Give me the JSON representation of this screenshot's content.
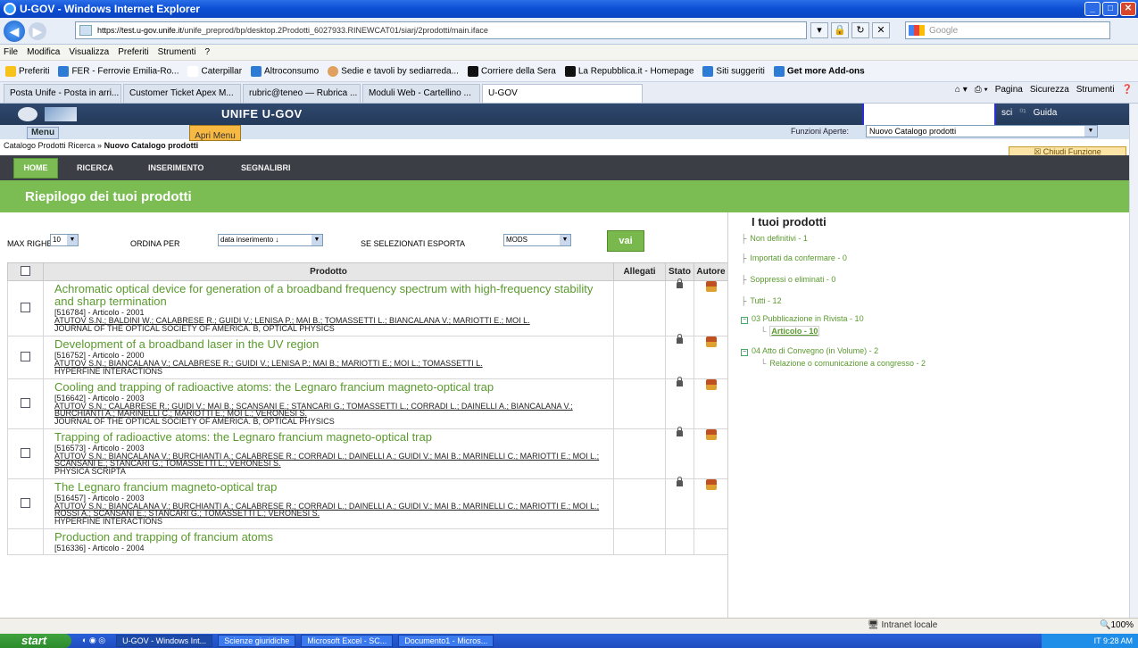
{
  "window": {
    "title": "U-GOV - Windows Internet Explorer"
  },
  "address": {
    "url_host": "https://test.u-gov.unife.it",
    "url_path": "/unife_preprod/bp/desktop.2Prodotti_6027933.RINEWCAT01/siarj/2prodotti/main.iface",
    "search_placeholder": "Google"
  },
  "menubar": [
    "File",
    "Modifica",
    "Visualizza",
    "Preferiti",
    "Strumenti",
    "?"
  ],
  "favorites": [
    "Preferiti",
    "FER - Ferrovie Emilia-Ro...",
    "Caterpillar",
    "Altroconsumo",
    "Sedie e tavoli by sediarreda...",
    "Corriere della Sera",
    "La Repubblica.it - Homepage",
    "Siti suggeriti",
    "Get more Add-ons"
  ],
  "tabs": [
    "Posta Unife - Posta in arri...",
    "Customer Ticket Apex M...",
    "rubric@teneo — Rubrica ...",
    "Moduli Web - Cartellino ...",
    "U-GOV"
  ],
  "tab_tools": [
    "Pagina",
    "Sicurezza",
    "Strumenti"
  ],
  "app": {
    "title": "UNIFE U-GOV",
    "links": [
      "sci",
      "Guida"
    ],
    "menu_btn": "Menu",
    "apri_btn": "Apri Menu",
    "funzioni_label": "Funzioni Aperte:",
    "funzioni_value": "Nuovo Catalogo prodotti",
    "breadcrumb_a": "Catalogo Prodotti Ricerca »",
    "breadcrumb_b": "Nuovo Catalogo prodotti",
    "chiudi": "Chiudi Funzione",
    "nav": [
      "HOME",
      "RICERCA",
      "INSERIMENTO",
      "SEGNALIBRI"
    ],
    "section_title": "Riepilogo dei tuoi prodotti"
  },
  "options": {
    "max_righe_label": "MAX RIGHE",
    "max_righe_value": "10",
    "ordina_label": "ORDINA PER",
    "ordina_value": "data inserimento ↓",
    "esporta_label": "SE SELEZIONATI ESPORTA",
    "esporta_value": "MODS",
    "vai": "vai"
  },
  "table": {
    "headers": {
      "prodotto": "Prodotto",
      "allegati": "Allegati",
      "stato": "Stato",
      "autore": "Autore"
    },
    "rows": [
      {
        "title": "Achromatic optical device for generation of a broadband frequency spectrum with high-frequency stability and sharp termination",
        "id": "[516784] - Articolo - 2001",
        "authors": "ATUTOV S.N.; BALDINI W.; CALABRESE R.; GUIDI V.; LENISA P.; MAI B.; TOMASSETTI L.; BIANCALANA V.; MARIOTTI E.; MOI L.",
        "journal": "JOURNAL OF THE OPTICAL SOCIETY OF AMERICA. B, OPTICAL PHYSICS"
      },
      {
        "title": "Development of a broadband laser in the UV region",
        "id": "[516752] - Articolo - 2000",
        "authors": "ATUTOV S.N.; BIANCALANA V.; CALABRESE R.; GUIDI V.; LENISA P.; MAI B.; MARIOTTI E.; MOI L.; TOMASSETTI L.",
        "journal": "HYPERFINE INTERACTIONS"
      },
      {
        "title": "Cooling and trapping of radioactive atoms: the Legnaro francium magneto-optical trap",
        "id": "[516642] - Articolo - 2003",
        "authors": "ATUTOV S.N.; CALABRESE R.; GUIDI V.; MAI B.; SCANSANI E.; STANCARI G.; TOMASSETTI L.; CORRADI L.; DAINELLI A.; BIANCALANA V.; BURCHIANTI A.; MARINELLI C.; MARIOTTI E.; MOI L.; VERONESI S.",
        "journal": "JOURNAL OF THE OPTICAL SOCIETY OF AMERICA. B, OPTICAL PHYSICS"
      },
      {
        "title": "Trapping of radioactive atoms: the Legnaro francium magneto-optical trap",
        "id": "[516573] - Articolo - 2003",
        "authors": "ATUTOV S.N.; BIANCALANA V.; BURCHIANTI A.; CALABRESE R.; CORRADI L.; DAINELLI A.; GUIDI V.; MAI B.; MARINELLI C.; MARIOTTI E.; MOI L.; SCANSANI E.; STANCARI G.; TOMASSETTI L.; VERONESI S.",
        "journal": "PHYSICA SCRIPTA"
      },
      {
        "title": "The Legnaro francium magneto-optical trap",
        "id": "[516457] - Articolo - 2003",
        "authors": "ATUTOV S.N.; BIANCALANA V.; BURCHIANTI A.; CALABRESE R.; CORRADI L.; DAINELLI A.; GUIDI V.; MAI B.; MARINELLI C.; MARIOTTI E.; MOI L.; ROSSI A.; SCANSANI E.; STANCARI G.; TOMASSETTI L.; VERONESI S.",
        "journal": "HYPERFINE INTERACTIONS"
      },
      {
        "title": "Production and trapping of francium atoms",
        "id": "[516336] - Articolo - 2004",
        "authors": "",
        "journal": ""
      }
    ]
  },
  "side": {
    "heading": "I tuoi prodotti",
    "items": {
      "non_definitivi": "Non definitivi - 1",
      "importati": "Importati da confermare - 0",
      "soppressi": "Soppressi o eliminati - 0",
      "tutti": "Tutti - 12",
      "cat03": "03 Pubblicazione in Rivista - 10",
      "articolo": "Articolo - 10",
      "cat04": "04 Atto di Convegno (in Volume) - 2",
      "relazione": "Relazione o comunicazione a congresso - 2"
    }
  },
  "status": {
    "zone": "Intranet locale",
    "zoom": "100%"
  },
  "taskbar": {
    "start": "start",
    "buttons": [
      "U-GOV - Windows Int...",
      "Scienze giuridiche",
      "Microsoft Excel - SC...",
      "Documento1 - Micros..."
    ],
    "lang": "IT",
    "time": "9:28 AM"
  }
}
